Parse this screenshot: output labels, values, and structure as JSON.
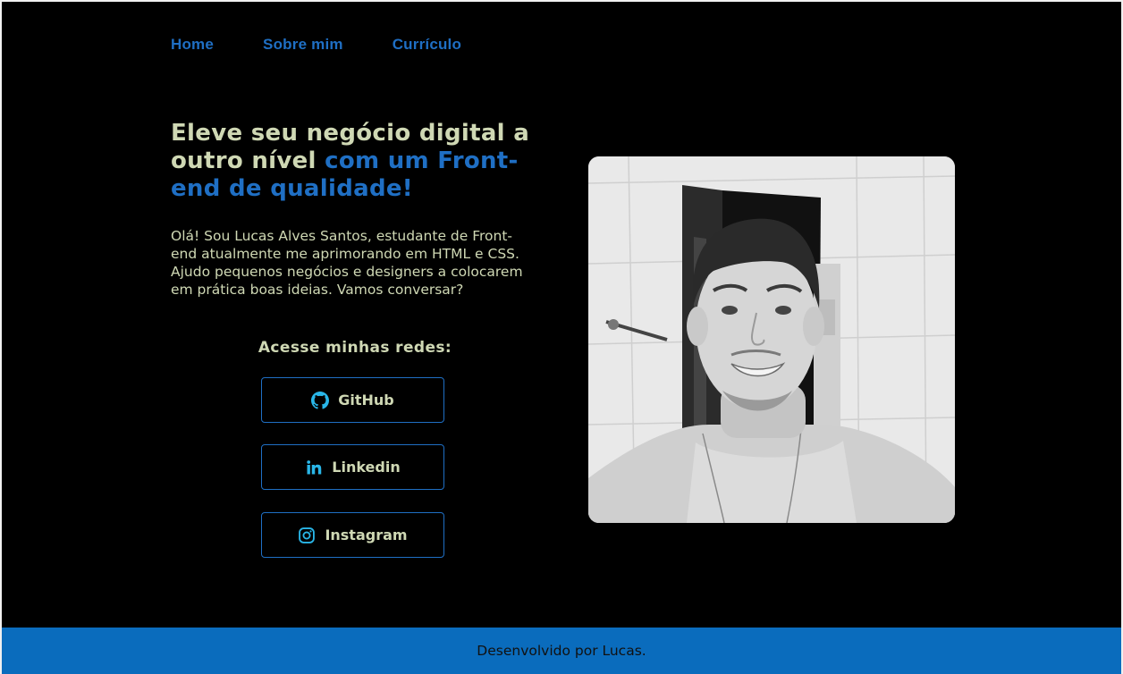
{
  "nav": {
    "items": [
      {
        "label": "Home"
      },
      {
        "label": "Sobre mim"
      },
      {
        "label": "Currículo"
      }
    ]
  },
  "hero": {
    "headline_part1": "Eleve seu negócio digital a outro nível",
    "headline_part2": "com um Front-end de qualidade!",
    "intro": "Olá! Sou Lucas Alves Santos, estudante de Front-end atualmente me aprimorando em HTML e CSS. Ajudo pequenos negócios e designers a colocarem em prática boas ideias. Vamos conversar?"
  },
  "social": {
    "title": "Acesse minhas redes:",
    "links": [
      {
        "label": "GitHub",
        "icon": "github-icon"
      },
      {
        "label": "Linkedin",
        "icon": "linkedin-icon"
      },
      {
        "label": "Instagram",
        "icon": "instagram-icon"
      }
    ]
  },
  "footer": {
    "text": "Desenvolvido por Lucas."
  },
  "colors": {
    "background": "#000000",
    "accent_blue": "#1f6fc4",
    "text_light": "#cfd8b4",
    "footer_bg": "#0a6cbd",
    "icon_cyan": "#29b6e8"
  }
}
